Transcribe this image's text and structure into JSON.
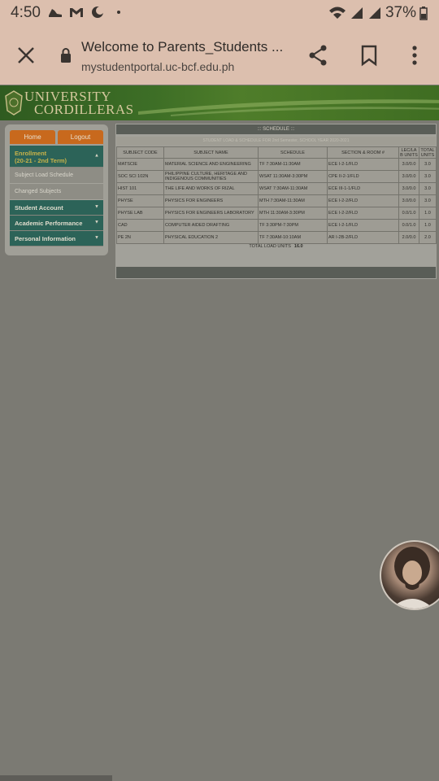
{
  "status": {
    "time": "4:50",
    "battery": "37%"
  },
  "browser": {
    "page_title": "Welcome to Parents_Students ...",
    "url": "mystudentportal.uc-bcf.edu.ph"
  },
  "banner": {
    "line1": "UNIVERSITY",
    "line2": "CORDILLERAS"
  },
  "sidebar": {
    "home_label": "Home",
    "logout_label": "Logout",
    "enrollment": {
      "label": "Enrollment",
      "term": "(20-21 - 2nd Term)"
    },
    "enrollment_items": [
      "Subject Load Schedule",
      "Changed Subjects"
    ],
    "sections": [
      "Student Account",
      "Academic Performance",
      "Personal Information"
    ]
  },
  "schedule": {
    "header": "::: SCHEDULE :::",
    "subheader": "STUDENT LOAD & SCHEDULE FOR 2nd Semester, SCHOOL YEAR 2020-2021",
    "columns": [
      "SUBJECT CODE",
      "SUBJECT NAME",
      "SCHEDULE",
      "SECTION & ROOM #",
      "LEC/LAB UNITS",
      "TOTAL UNITS"
    ],
    "rows": [
      [
        "MATSCIE",
        "MATERIAL SCIENCE AND ENGINEERING",
        "TF 7:30AM-11:30AM",
        "ECE I-2-1/FLD",
        "3.0/0.0",
        "3.0"
      ],
      [
        "SOC SCI 102N",
        "PHILIPPINE CULTURE, HERITAGE AND INDIGENOUS COMMUNITIES",
        "WSAT 11:30AM-3:30PM",
        "CPE II-2-1/FLD",
        "3.0/0.0",
        "3.0"
      ],
      [
        "HIST 101",
        "THE LIFE AND WORKS OF RIZAL",
        "WSAT 7:30AM-11:30AM",
        "ECE III-1-1/FLD",
        "3.0/0.0",
        "3.0"
      ],
      [
        "PHYSE",
        "PHYSICS FOR ENGINEERS",
        "MTH 7:30AM-11:30AM",
        "ECE I-2-2/FLD",
        "3.0/0.0",
        "3.0"
      ],
      [
        "PHYSE LAB",
        "PHYSICS FOR ENGINEERS LABORATORY",
        "MTH 11:30AM-3:30PM",
        "ECE I-2-2/FLD",
        "0.0/1.0",
        "1.0"
      ],
      [
        "CAD",
        "COMPUTER AIDED DRAFTING",
        "TF 3:30PM-7:30PM",
        "ECE I-2-1/FLD",
        "0.0/1.0",
        "1.0"
      ],
      [
        "PE 2N",
        "PHYSICAL EDUCATION 2",
        "TF 7:30AM-10:10AM",
        "AR I-2B-2/FLD",
        "2.0/0.0",
        "2.0"
      ]
    ],
    "total_label": "TOTAL LOAD UNITS",
    "total_value": "16.0"
  }
}
